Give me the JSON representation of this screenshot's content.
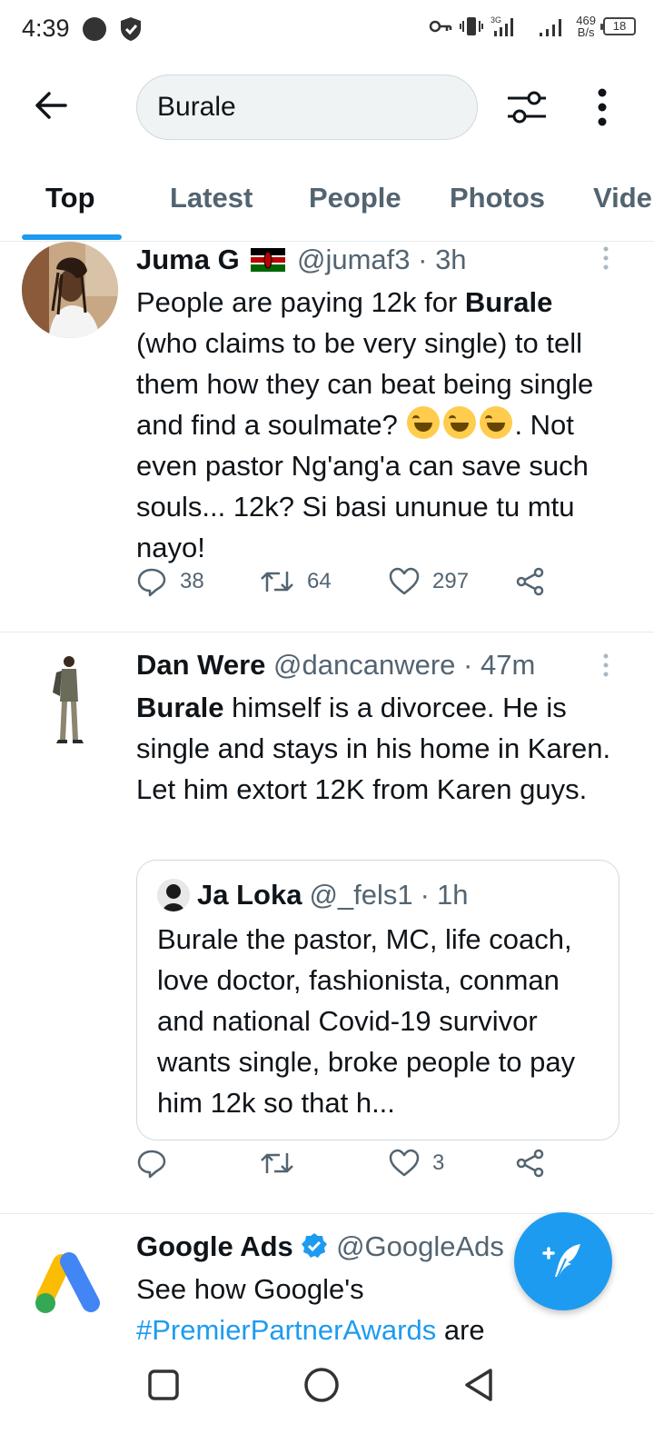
{
  "status_bar": {
    "time": "4:39",
    "net_speed_value": "469",
    "net_speed_unit": "B/s",
    "battery": "18"
  },
  "search": {
    "query": "Burale"
  },
  "tabs": [
    {
      "label": "Top",
      "active": true
    },
    {
      "label": "Latest",
      "active": false
    },
    {
      "label": "People",
      "active": false
    },
    {
      "label": "Photos",
      "active": false
    },
    {
      "label": "Vide",
      "active": false
    }
  ],
  "tweets": [
    {
      "name": "Juma G",
      "handle": "@jumaf3",
      "time": "3h",
      "text_bold": "Burale",
      "text_pre": "People are paying 12k for ",
      "text_post_1": " (who claims to be very single) to tell them how they can beat being single and find a soulmate? ",
      "text_post_2": ". Not even pastor Ng'ang'a can save such souls... 12k? Si basi ununue tu mtu nayo!",
      "replies": "38",
      "retweets": "64",
      "likes": "297"
    },
    {
      "name": "Dan Were",
      "handle": "@dancanwere",
      "time": "47m",
      "text_bold": "Burale",
      "text_post": " himself is a divorcee. He is single and stays in his home in Karen. Let him extort 12K from Karen guys.",
      "quote": {
        "name": "Ja Loka",
        "handle": "@_fels1",
        "time": "1h",
        "text": "Burale the pastor, MC, life coach, love doctor, fashionista, conman and national Covid-19 survivor  wants single, broke people to pay him 12k so that h..."
      },
      "replies": "",
      "retweets": "",
      "likes": "3"
    },
    {
      "name": "Google Ads",
      "handle": "@GoogleAds",
      "text_pre": "See how Google's ",
      "hashtag": "#PremierPartnerAwards",
      "text_post": " are"
    }
  ],
  "separator": "·",
  "colors": {
    "accent": "#1d9bf0",
    "text_primary": "#0f1419",
    "text_secondary": "#536471",
    "divider": "#e6ecf0"
  }
}
